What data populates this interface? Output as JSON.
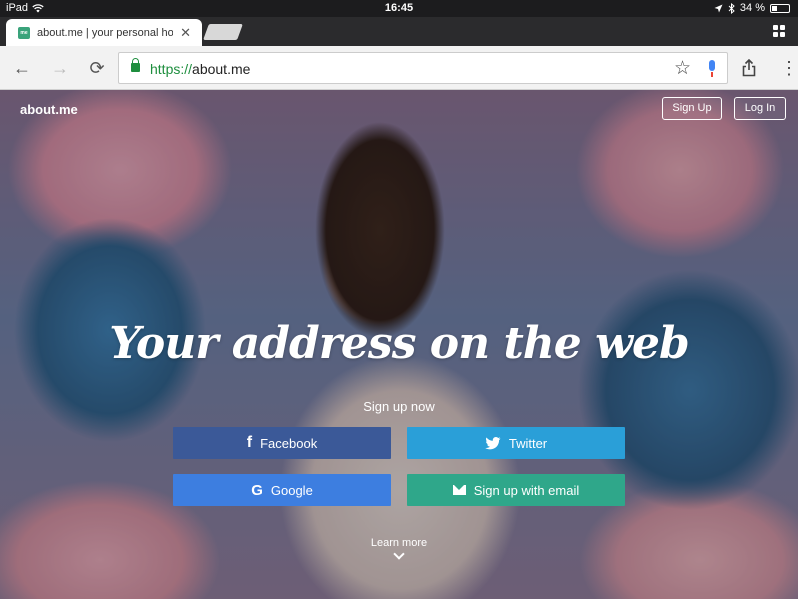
{
  "status_bar": {
    "device": "iPad",
    "time": "16:45",
    "battery": "34 %",
    "battery_level": 0.34
  },
  "tab": {
    "title": "about.me | your personal ho",
    "favicon_text": "me"
  },
  "toolbar": {
    "url_scheme": "https://",
    "url_host": "about.me"
  },
  "header": {
    "brand": "about.me",
    "signup_label": "Sign Up",
    "login_label": "Log In"
  },
  "hero": {
    "headline": "Your address on the web",
    "signup_prompt": "Sign up now",
    "learn_more": "Learn more"
  },
  "buttons": {
    "facebook": "Facebook",
    "twitter": "Twitter",
    "google": "Google",
    "email": "Sign up with email"
  },
  "colors": {
    "facebook": "#3b5998",
    "twitter": "#2a9fd8",
    "google": "#3d7ee0",
    "email": "#2fa78a",
    "secure": "#1e8e3e"
  }
}
